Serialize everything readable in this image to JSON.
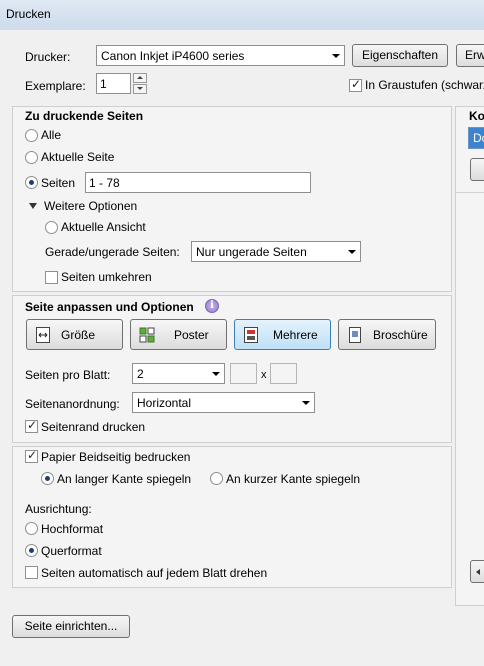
{
  "window": {
    "title": "Drucken"
  },
  "printer": {
    "label": "Drucker:",
    "selected": "Canon Inkjet iP4600 series",
    "properties_button": "Eigenschaften",
    "advanced_button": "Erw"
  },
  "copies": {
    "label": "Exemplare:",
    "value": "1"
  },
  "grayscale": {
    "label": "In Graustufen (schwarz",
    "checked": true
  },
  "pages_section": {
    "title": "Zu druckende Seiten",
    "all": "Alle",
    "current": "Aktuelle Seite",
    "pages": "Seiten",
    "pages_value": "1 - 78",
    "more_options": "Weitere Optionen",
    "current_view": "Aktuelle Ansicht",
    "even_odd_label": "Gerade/ungerade Seiten:",
    "even_odd_value": "Nur ungerade Seiten",
    "reverse": "Seiten umkehren"
  },
  "fit_section": {
    "title": "Seite anpassen und Optionen",
    "size_button": "Größe",
    "poster_button": "Poster",
    "multiple_button": "Mehrere",
    "booklet_button": "Broschüre",
    "pages_per_sheet_label": "Seiten pro Blatt:",
    "pages_per_sheet_value": "2",
    "x_label": "x",
    "order_label": "Seitenanordnung:",
    "order_value": "Horizontal",
    "border": "Seitenrand drucken"
  },
  "duplex_section": {
    "duplex": "Papier Beidseitig bedrucken",
    "long_edge": "An langer Kante spiegeln",
    "short_edge": "An kurzer Kante spiegeln",
    "orientation_label": "Ausrichtung:",
    "portrait": "Hochformat",
    "landscape": "Querformat",
    "auto_rotate": "Seiten automatisch auf jedem Blatt drehen"
  },
  "comments": {
    "title": "Ko",
    "value": "Do"
  },
  "footer": {
    "page_setup_button": "Seite einrichten..."
  }
}
